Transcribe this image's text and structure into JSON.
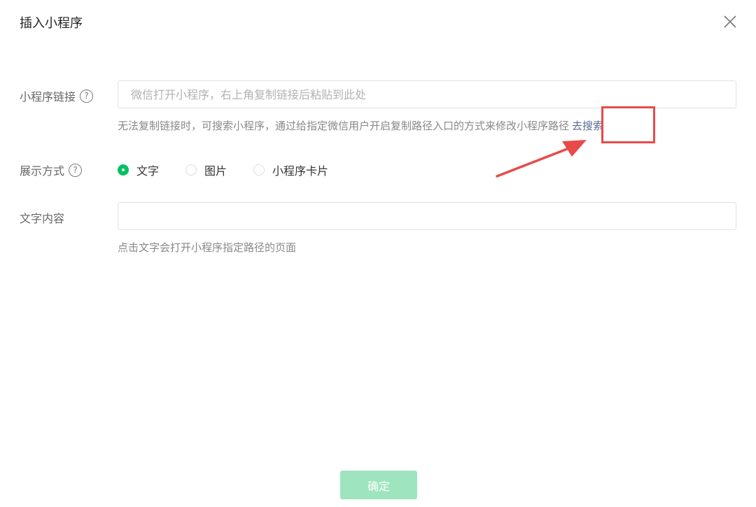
{
  "dialog": {
    "title": "插入小程序"
  },
  "link_field": {
    "label": "小程序链接",
    "placeholder": "微信打开小程序，右上角复制链接后粘贴到此处",
    "value": "",
    "hint": "无法复制链接时，可搜索小程序，通过给指定微信用户开启复制路径入口的方式来修改小程序路径",
    "search_link": "去搜索"
  },
  "display_mode": {
    "label": "展示方式",
    "options": [
      {
        "label": "文字",
        "checked": true
      },
      {
        "label": "图片",
        "checked": false
      },
      {
        "label": "小程序卡片",
        "checked": false
      }
    ]
  },
  "text_field": {
    "label": "文字内容",
    "value": "",
    "hint": "点击文字会打开小程序指定路径的页面"
  },
  "footer": {
    "confirm_label": "确定"
  },
  "icons": {
    "close": "close-icon",
    "help": "question-circle-icon"
  },
  "colors": {
    "accent_green": "#07c160",
    "link_blue": "#576b95",
    "annotation_red": "#e84a4a",
    "confirm_disabled": "#9de4bf"
  }
}
